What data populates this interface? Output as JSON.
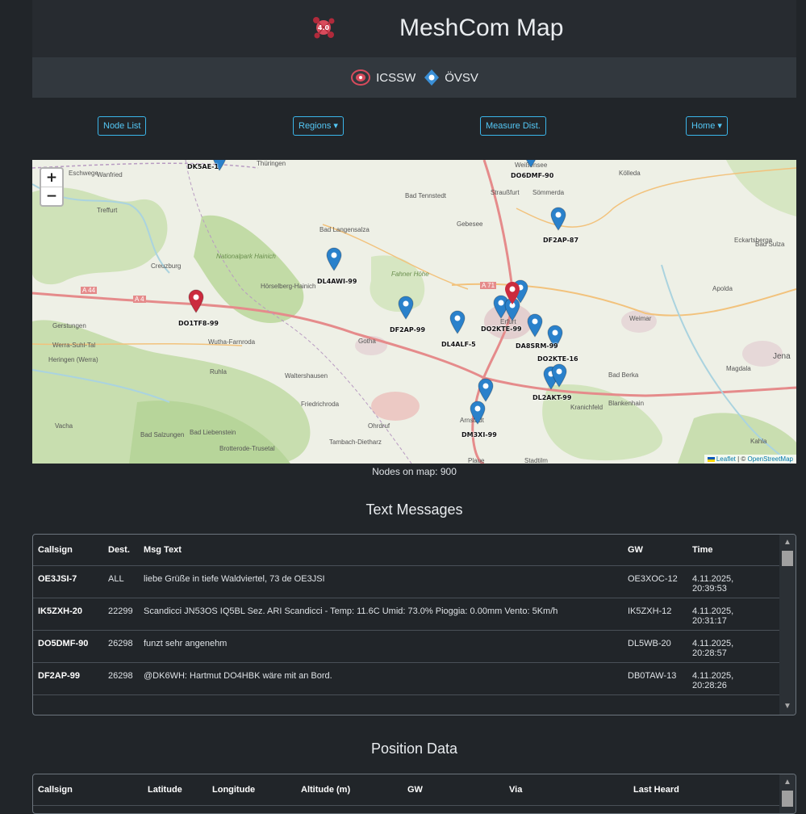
{
  "header": {
    "title": "MeshCom Map",
    "logo_badge": "4.0"
  },
  "subbar": {
    "org1": "ICSSW",
    "org2": "ÖVSV"
  },
  "nav": {
    "node_list": "Node List",
    "regions": "Regions",
    "measure": "Measure Dist.",
    "home": "Home"
  },
  "map": {
    "zoom_in": "+",
    "zoom_out": "−",
    "attribution_leaflet": "Leaflet",
    "attribution_sep": " | © ",
    "attribution_osm": "OpenStreetMap",
    "markers": [
      {
        "label": "DK5AE-1",
        "color": "blue"
      },
      {
        "label": "DO6DMF-90",
        "color": "blue"
      },
      {
        "label": "DF2AP-87",
        "color": "blue"
      },
      {
        "label": "DL4AWI-99",
        "color": "blue"
      },
      {
        "label": "DO1TF8-99",
        "color": "red"
      },
      {
        "label": "DF2AP-99",
        "color": "blue"
      },
      {
        "label": "DL4ALF-5",
        "color": "blue"
      },
      {
        "label": "DO2KTE-99",
        "color": "blue"
      },
      {
        "label": "DA8SRM-99",
        "color": "blue"
      },
      {
        "label": "DO2KTE-16",
        "color": "blue"
      },
      {
        "label": "DL2AKT-99",
        "color": "blue"
      },
      {
        "label": "DM3XI-99",
        "color": "blue"
      }
    ],
    "places": [
      "Eschwege",
      "Wanfried",
      "Treffurt",
      "Creuzburg",
      "Bad Langensalza",
      "Bad Tennstedt",
      "Straußfurt",
      "Sömmerda",
      "Kölleda",
      "Gebesee",
      "Eckartsberga",
      "Bad Sulza",
      "Apolda",
      "Weimar",
      "Jena",
      "Gotha",
      "Ruhla",
      "Waltershausen",
      "Friedrichroda",
      "Ohrdruf",
      "Arnstadt",
      "Kranichfeld",
      "Blankenhain",
      "Bad Berka",
      "Magdala",
      "Kahla",
      "Hörselberg-Hainich",
      "Wutha-Farnroda",
      "Gerstungen",
      "Bad Salzungen",
      "Bad Liebenstein",
      "Brotterode-Trusetal",
      "Tambach-Dietharz",
      "Vacha",
      "Heringen (Werra)",
      "Werra-Suhl-Tal",
      "Thüringen",
      "Plaue",
      "Stadtilm",
      "Weißensee",
      "Erfurt",
      "Nationalpark Hainich",
      "Fahner Höhe",
      "A 44",
      "A 4",
      "A 71"
    ]
  },
  "node_count": "Nodes on map: 900",
  "text_messages": {
    "title": "Text Messages",
    "columns": [
      "Callsign",
      "Dest.",
      "Msg Text",
      "GW",
      "Time"
    ],
    "rows": [
      [
        "OE3JSI-7",
        "ALL",
        "liebe Grüße in tiefe Waldviertel, 73 de OE3JSI",
        "OE3XOC-12",
        "4.11.2025,",
        "20:39:53"
      ],
      [
        "IK5ZXH-20",
        "22299",
        "Scandicci JN53OS IQ5BL Sez. ARI Scandicci - Temp: 11.6C Umid: 73.0% Pioggia: 0.00mm Vento: 5Km/h",
        "IK5ZXH-12",
        "4.11.2025,",
        "20:31:17"
      ],
      [
        "DO5DMF-90",
        "26298",
        "funzt sehr angenehm",
        "DL5WB-20",
        "4.11.2025,",
        "20:28:57"
      ],
      [
        "DF2AP-99",
        "26298",
        "@DK6WH: Hartmut DO4HBK wäre mit an Bord.",
        "DB0TAW-13",
        "4.11.2025,",
        "20:28:26"
      ]
    ]
  },
  "position_data": {
    "title": "Position Data",
    "columns": [
      "Callsign",
      "Latitude",
      "Longitude",
      "Altitude (m)",
      "GW",
      "Via",
      "Last Heard"
    ]
  },
  "colors": {
    "accent": "#3bb6ea",
    "bg": "#212529",
    "marker_blue": "#2a81cb",
    "marker_red": "#cb2b3e"
  }
}
